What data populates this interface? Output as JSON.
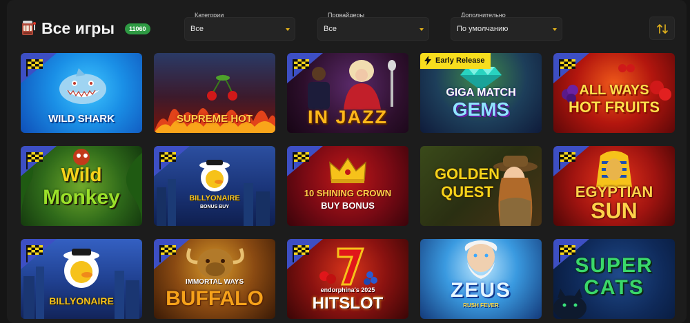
{
  "header": {
    "title": "Все игры",
    "count": "11060",
    "filters": [
      {
        "label": "Категории",
        "value": "Все"
      },
      {
        "label": "Провайдеры",
        "value": "Все"
      },
      {
        "label": "Дополнительно",
        "value": "По умолчанию"
      }
    ],
    "sort_icon": "sort-arrows-icon"
  },
  "early_release": "Early Release",
  "games": [
    {
      "title": "WILD SHARK",
      "sub": ""
    },
    {
      "title": "SUPREME HOT",
      "sub": ""
    },
    {
      "title": "IN JAZZ",
      "sub": ""
    },
    {
      "title": "GIGA MATCH",
      "sub": "GEMS"
    },
    {
      "title": "ALL WAYS",
      "sub": "HOT FRUITS"
    },
    {
      "title": "Wild",
      "sub": "Monkey"
    },
    {
      "title": "BILLYONAIRE",
      "sub": "BONUS BUY"
    },
    {
      "title": "10 SHINING CROWN",
      "sub": "BUY BONUS"
    },
    {
      "title": "GOLDEN",
      "sub": "QUEST"
    },
    {
      "title": "EGYPTIAN",
      "sub": "SUN"
    },
    {
      "title": "BILLYONAIRE",
      "sub": ""
    },
    {
      "title": "IMMORTAL WAYS",
      "sub": "BUFFALO"
    },
    {
      "title": "endorphina's 2025",
      "sub": "HITSLOT"
    },
    {
      "title": "ZEUS",
      "sub": "RUSH FEVER"
    },
    {
      "title": "SUPER",
      "sub": "CATS"
    }
  ],
  "colors": {
    "accent": "#e3b21b",
    "count_badge": "#2e9a43",
    "early_release": "#f7dd1e",
    "flag_badge": "#3d4fc4"
  }
}
